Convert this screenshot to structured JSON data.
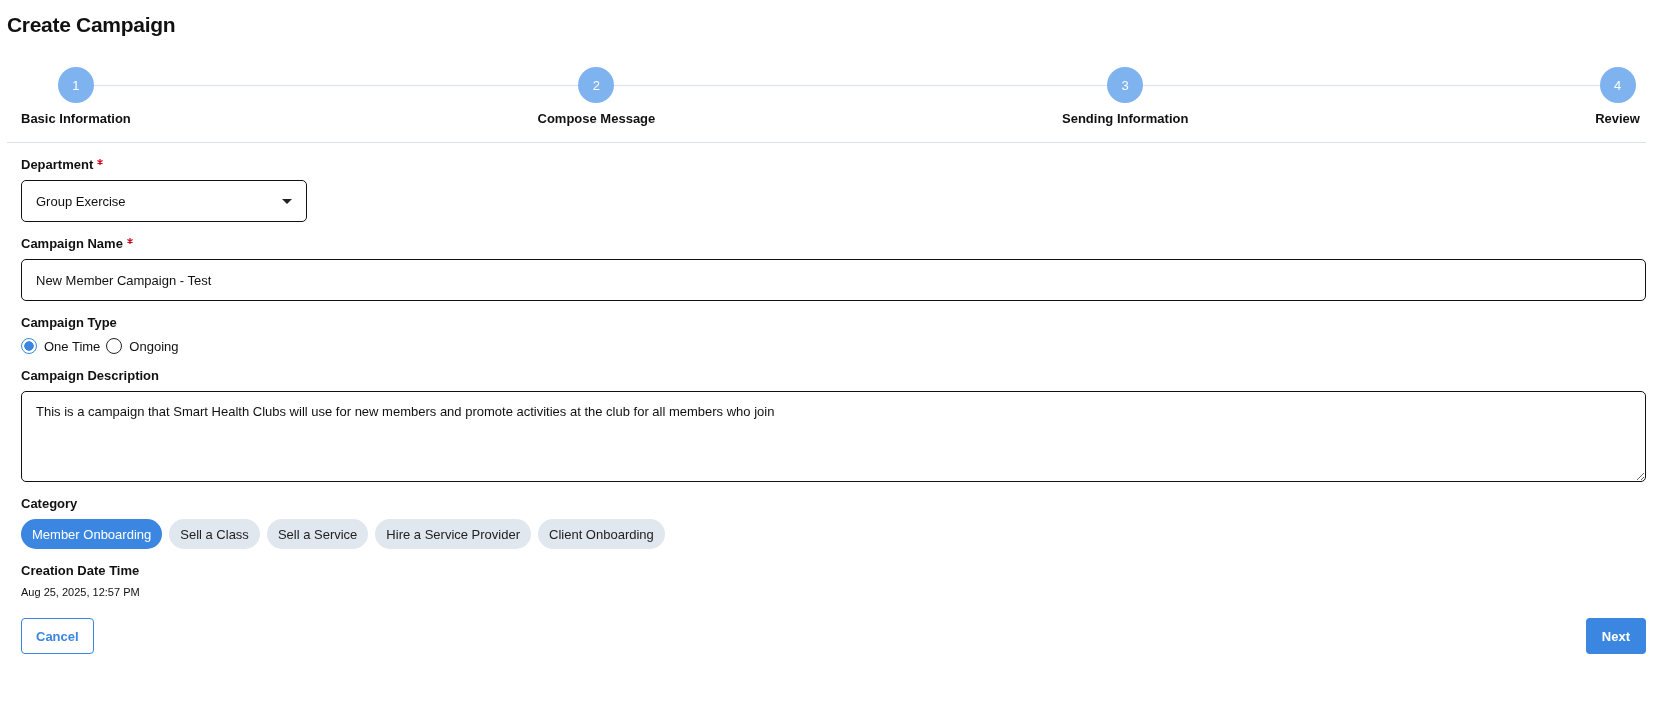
{
  "page": {
    "title": "Create Campaign"
  },
  "steps": [
    {
      "number": "1",
      "label": "Basic Information"
    },
    {
      "number": "2",
      "label": "Compose Message"
    },
    {
      "number": "3",
      "label": "Sending Information"
    },
    {
      "number": "4",
      "label": "Review"
    }
  ],
  "department": {
    "label": "Department",
    "required": true,
    "value": "Group Exercise"
  },
  "campaign_name": {
    "label": "Campaign Name",
    "required": true,
    "value": "New Member Campaign - Test"
  },
  "campaign_type": {
    "label": "Campaign Type",
    "options": [
      {
        "label": "One Time",
        "selected": true
      },
      {
        "label": "Ongoing",
        "selected": false
      }
    ]
  },
  "description": {
    "label": "Campaign Description",
    "value": "This is a campaign that Smart Health Clubs will use for new members and promote activities at the club for all members who join"
  },
  "category": {
    "label": "Category",
    "options": [
      {
        "label": "Member Onboarding",
        "selected": true
      },
      {
        "label": "Sell a Class",
        "selected": false
      },
      {
        "label": "Sell a Service",
        "selected": false
      },
      {
        "label": "Hire a Service Provider",
        "selected": false
      },
      {
        "label": "Client Onboarding",
        "selected": false
      }
    ]
  },
  "creation": {
    "label": "Creation Date Time",
    "value": "Aug 25, 2025, 12:57 PM"
  },
  "buttons": {
    "cancel": "Cancel",
    "next": "Next"
  }
}
